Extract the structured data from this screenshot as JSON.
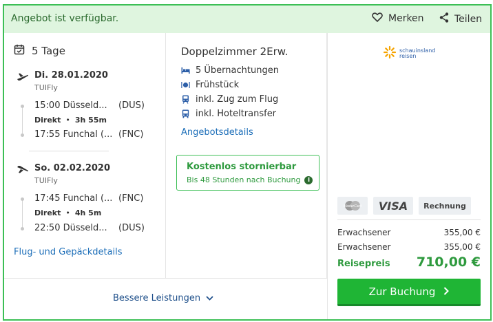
{
  "header": {
    "availability": "Angebot ist verfügbar.",
    "save_label": "Merken",
    "share_label": "Teilen"
  },
  "trip": {
    "duration": "5 Tage",
    "outbound": {
      "date": "Di. 28.01.2020",
      "airline": "TUIFly",
      "dep_time_place": "15:00 Düsseld...",
      "dep_code": "(DUS)",
      "direct_label": "Direkt",
      "flight_duration": "3h 55m",
      "arr_time_place": "17:55 Funchal (...",
      "arr_code": "(FNC)"
    },
    "inbound": {
      "date": "So. 02.02.2020",
      "airline": "TUIFly",
      "dep_time_place": "17:45 Funchal (...",
      "dep_code": "(FNC)",
      "direct_label": "Direkt",
      "flight_duration": "4h 5m",
      "arr_time_place": "22:50 Düsseld...",
      "arr_code": "(DUS)"
    },
    "details_link": "Flug- und Gepäckdetails"
  },
  "room": {
    "title": "Doppelzimmer 2Erw.",
    "features": [
      {
        "icon": "bed-icon",
        "label": "5 Übernachtungen"
      },
      {
        "icon": "restaurant-icon",
        "label": "Frühstück"
      },
      {
        "icon": "train-icon",
        "label": "inkl. Zug zum Flug"
      },
      {
        "icon": "bus-icon",
        "label": "inkl. Hoteltransfer"
      }
    ],
    "details_link": "Angebotsdetails",
    "cancellation": {
      "title": "Kostenlos stornierbar",
      "subtitle": "Bis 48 Stunden nach Buchung"
    }
  },
  "provider": {
    "logo_line1": "schauinsland",
    "logo_line2": "reisen"
  },
  "payment": {
    "methods": [
      "MasterCard",
      "VISA",
      "Rechnung"
    ]
  },
  "price": {
    "rows": [
      {
        "label": "Erwachsener",
        "value": "355,00 €"
      },
      {
        "label": "Erwachsener",
        "value": "355,00 €"
      }
    ],
    "total_label": "Reisepreis",
    "total_value": "710,00 €",
    "book_label": "Zur Buchung"
  },
  "footer": {
    "better_label": "Bessere Leistungen"
  },
  "colors": {
    "accent_green": "#1fb535",
    "border_green": "#3cbf55",
    "link_blue": "#1e6fb9",
    "header_bg": "#dff5df"
  }
}
